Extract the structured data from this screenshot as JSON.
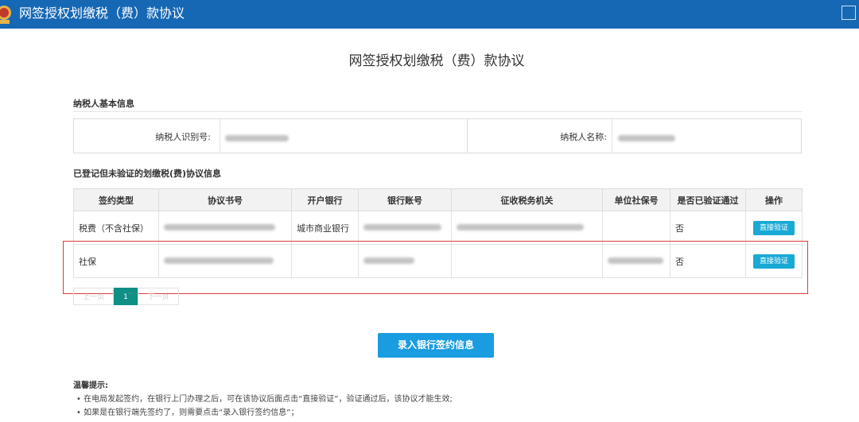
{
  "window": {
    "title": "网签授权划缴税（费）款协议"
  },
  "page": {
    "title": "网签授权划缴税（费）款协议"
  },
  "taxpayer_section": {
    "heading": "纳税人基本信息",
    "id_label": "纳税人识别号:",
    "name_label": "纳税人名称:"
  },
  "agreement_section": {
    "heading": "已登记但未验证的划缴税(费)协议信息",
    "columns": [
      "签约类型",
      "协议书号",
      "开户银行",
      "银行账号",
      "征收税务机关",
      "单位社保号",
      "是否已验证通过",
      "操作"
    ],
    "rows": [
      {
        "type": "税费（不含社保）",
        "bank": "城市商业银行",
        "verified": "否",
        "action": "直接验证"
      },
      {
        "type": "社保",
        "bank": "",
        "verified": "否",
        "action": "直接验证"
      }
    ]
  },
  "pager": {
    "prev": "上一页",
    "current": "1",
    "next": "下一页"
  },
  "primary_button": "录入银行签约信息",
  "tips": {
    "title": "温馨提示:",
    "items": [
      "• 在电局发起签约，在银行上门办理之后，可在该协议后面点击“直接验证”，验证通过后，该协议才能生效;",
      "• 如果是在银行端先签约了，则需要点击“录入银行签约信息”；"
    ]
  },
  "colors": {
    "titlebar": "#1668b5",
    "action_button": "#18a9d5",
    "primary_button": "#1a9ce0",
    "pager_current": "#0f8f86",
    "highlight": "#e03a3a"
  }
}
